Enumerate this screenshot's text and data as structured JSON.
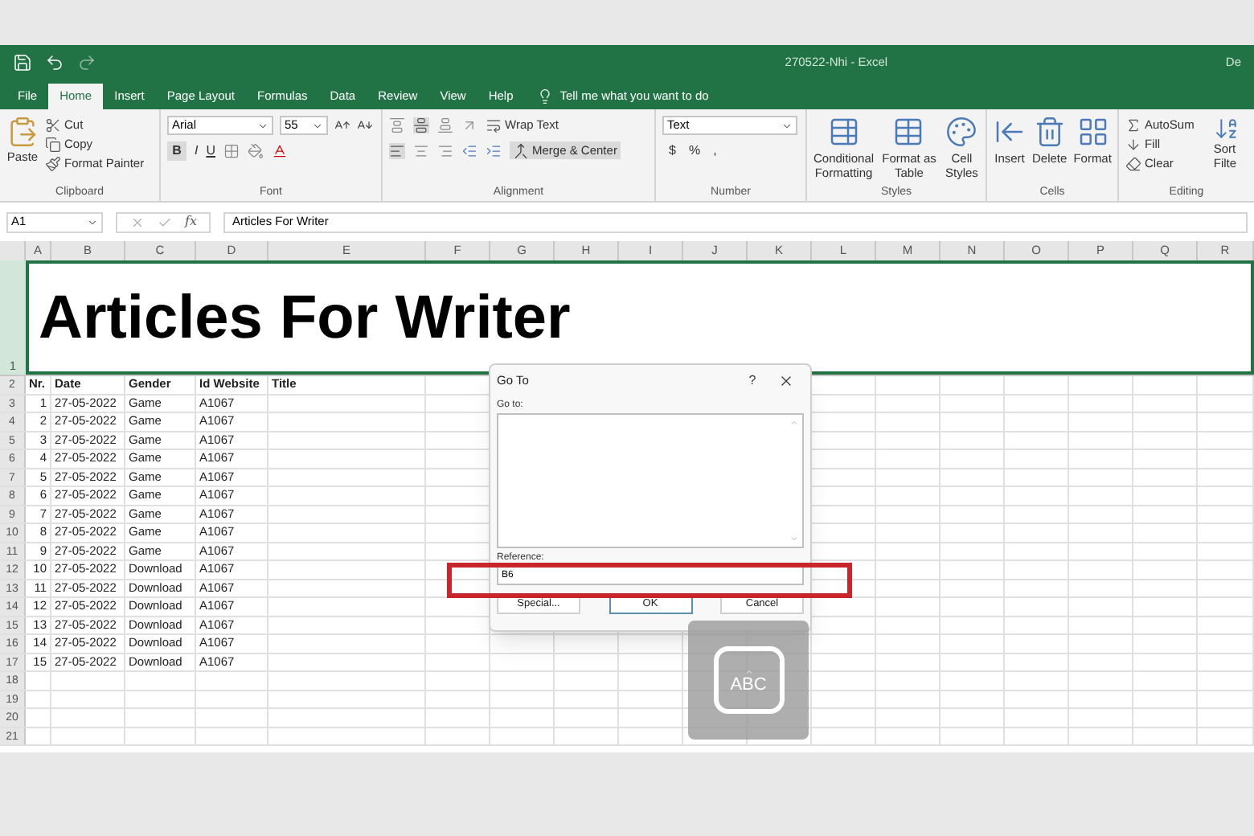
{
  "window": {
    "title": "270522-Nhi  -  Excel",
    "user": "De"
  },
  "tabs": [
    {
      "label": "File",
      "selected": false
    },
    {
      "label": "Home",
      "selected": true
    },
    {
      "label": "Insert",
      "selected": false
    },
    {
      "label": "Page Layout",
      "selected": false
    },
    {
      "label": "Formulas",
      "selected": false
    },
    {
      "label": "Data",
      "selected": false
    },
    {
      "label": "Review",
      "selected": false
    },
    {
      "label": "View",
      "selected": false
    },
    {
      "label": "Help",
      "selected": false
    }
  ],
  "tell_me": "Tell me what you want to do",
  "clipboard": {
    "label": "Clipboard",
    "paste": "Paste",
    "cut": "Cut",
    "copy": "Copy",
    "format_painter": "Format Painter"
  },
  "font": {
    "label": "Font",
    "family": "Arial",
    "size": "55",
    "bold": "B",
    "italic": "I",
    "underline": "U"
  },
  "alignment": {
    "label": "Alignment",
    "wrap_text": "Wrap Text",
    "merge": "Merge & Center"
  },
  "number": {
    "label": "Number",
    "format": "Text",
    "currency": "$",
    "percent": "%",
    "comma": ","
  },
  "styles": {
    "label": "Styles",
    "items": [
      "Conditional Formatting",
      "Format as Table",
      "Cell Styles"
    ]
  },
  "cells": {
    "label": "Cells",
    "items": [
      "Insert",
      "Delete",
      "Format"
    ]
  },
  "editing": {
    "label": "Editing",
    "autosum": "AutoSum",
    "fill": "Fill",
    "clear": "Clear",
    "sort_lines": [
      "Sort",
      "Filte"
    ]
  },
  "formula_bar": {
    "name_box": "A1",
    "function_label": "fx",
    "content": "Articles For Writer"
  },
  "columns": [
    "A",
    "B",
    "C",
    "D",
    "E",
    "F",
    "G",
    "H",
    "I",
    "J",
    "K",
    "L",
    "M",
    "N",
    "O",
    "P",
    "Q",
    "R"
  ],
  "title_row": {
    "number": "1",
    "text": "Articles For Writer",
    "selected": true
  },
  "rows": [
    {
      "number": "2",
      "kind": "header",
      "cells": [
        "Nr.",
        "Date",
        "Gender",
        "Id Website",
        "Title"
      ]
    },
    {
      "number": "3",
      "kind": "data",
      "cells": [
        "1",
        "27-05-2022",
        "Game",
        "A1067"
      ]
    },
    {
      "number": "4",
      "kind": "data",
      "cells": [
        "2",
        "27-05-2022",
        "Game",
        "A1067"
      ]
    },
    {
      "number": "5",
      "kind": "data",
      "cells": [
        "3",
        "27-05-2022",
        "Game",
        "A1067"
      ]
    },
    {
      "number": "6",
      "kind": "data",
      "cells": [
        "4",
        "27-05-2022",
        "Game",
        "A1067"
      ]
    },
    {
      "number": "7",
      "kind": "data",
      "cells": [
        "5",
        "27-05-2022",
        "Game",
        "A1067"
      ]
    },
    {
      "number": "8",
      "kind": "data",
      "cells": [
        "6",
        "27-05-2022",
        "Game",
        "A1067"
      ]
    },
    {
      "number": "9",
      "kind": "data",
      "cells": [
        "7",
        "27-05-2022",
        "Game",
        "A1067"
      ]
    },
    {
      "number": "10",
      "kind": "data",
      "cells": [
        "8",
        "27-05-2022",
        "Game",
        "A1067"
      ]
    },
    {
      "number": "11",
      "kind": "data",
      "cells": [
        "9",
        "27-05-2022",
        "Game",
        "A1067"
      ]
    },
    {
      "number": "12",
      "kind": "data",
      "cells": [
        "10",
        "27-05-2022",
        "Download",
        "A1067"
      ]
    },
    {
      "number": "13",
      "kind": "data",
      "cells": [
        "11",
        "27-05-2022",
        "Download",
        "A1067"
      ]
    },
    {
      "number": "14",
      "kind": "data",
      "cells": [
        "12",
        "27-05-2022",
        "Download",
        "A1067"
      ]
    },
    {
      "number": "15",
      "kind": "data",
      "cells": [
        "13",
        "27-05-2022",
        "Download",
        "A1067"
      ]
    },
    {
      "number": "16",
      "kind": "data",
      "cells": [
        "14",
        "27-05-2022",
        "Download",
        "A1067"
      ]
    },
    {
      "number": "17",
      "kind": "data",
      "cells": [
        "15",
        "27-05-2022",
        "Download",
        "A1067"
      ]
    },
    {
      "number": "18",
      "kind": "data",
      "cells": []
    },
    {
      "number": "19",
      "kind": "data",
      "cells": []
    },
    {
      "number": "20",
      "kind": "data",
      "cells": []
    },
    {
      "number": "21",
      "kind": "data",
      "cells": []
    }
  ],
  "dialog": {
    "title": "Go To",
    "help": "?",
    "go_to_label": "Go to:",
    "reference_label": "Reference:",
    "reference_value": "B6",
    "buttons": [
      {
        "label": "Special...",
        "focused": false
      },
      {
        "label": "OK",
        "focused": true
      },
      {
        "label": "Cancel",
        "focused": false
      }
    ]
  },
  "input_indicator": {
    "text": "ABC"
  }
}
